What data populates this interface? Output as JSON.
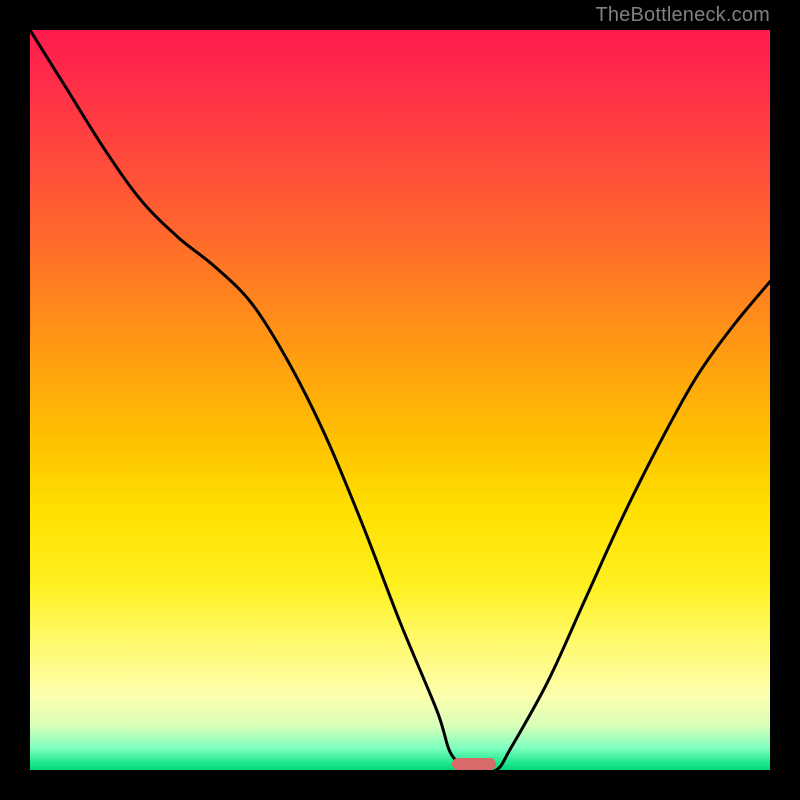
{
  "watermark": "TheBottleneck.com",
  "chart_data": {
    "type": "line",
    "title": "",
    "xlabel": "",
    "ylabel": "",
    "xlim": [
      0,
      100
    ],
    "ylim": [
      0,
      100
    ],
    "x": [
      0,
      5,
      10,
      15,
      20,
      25,
      30,
      35,
      40,
      45,
      50,
      55,
      57,
      60,
      63,
      65,
      70,
      75,
      80,
      85,
      90,
      95,
      100
    ],
    "values": [
      100,
      92,
      84,
      77,
      72,
      68,
      63,
      55,
      45,
      33,
      20,
      8,
      2,
      0,
      0,
      3,
      12,
      23,
      34,
      44,
      53,
      60,
      66
    ],
    "marker_x_range": [
      57,
      63
    ],
    "background_gradient": {
      "top": "#ff1a4d",
      "mid": "#ffe000",
      "bottom": "#00d878"
    }
  },
  "colors": {
    "frame": "#000000",
    "curve": "#000000",
    "marker": "#d86a6a",
    "watermark": "#808080"
  }
}
